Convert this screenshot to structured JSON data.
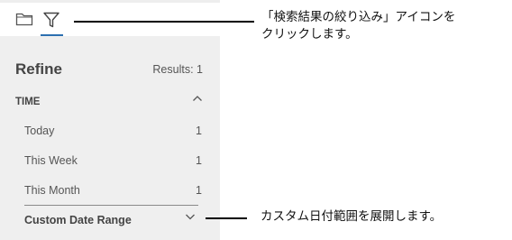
{
  "toolbar": {
    "folder_icon": "folder-icon",
    "filter_icon": "filter-icon",
    "active_color": "#2c6fb0"
  },
  "panel": {
    "title": "Refine",
    "results_label": "Results:",
    "results_count": "1",
    "section": {
      "title": "TIME",
      "options": [
        {
          "label": "Today",
          "count": "1"
        },
        {
          "label": "This Week",
          "count": "1"
        },
        {
          "label": "This Month",
          "count": "1"
        }
      ],
      "custom_range_label": "Custom Date Range"
    }
  },
  "callouts": {
    "filter_line1": "「検索結果の絞り込み」アイコンを",
    "filter_line2": "クリックします。",
    "custom_range": "カスタム日付範囲を展開します。"
  }
}
